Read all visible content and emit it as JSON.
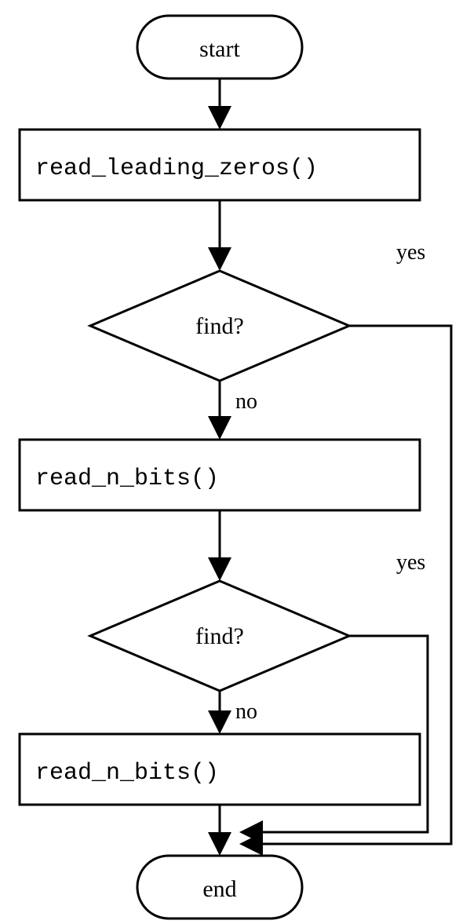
{
  "chart_data": {
    "type": "flowchart",
    "nodes": [
      {
        "id": "start",
        "kind": "terminator",
        "label": "start"
      },
      {
        "id": "p1",
        "kind": "process",
        "label": "read_leading_zeros()"
      },
      {
        "id": "d1",
        "kind": "decision",
        "label": "find?"
      },
      {
        "id": "p2",
        "kind": "process",
        "label": "read_n_bits()"
      },
      {
        "id": "d2",
        "kind": "decision",
        "label": "find?"
      },
      {
        "id": "p3",
        "kind": "process",
        "label": "read_n_bits()"
      },
      {
        "id": "end",
        "kind": "terminator",
        "label": "end"
      }
    ],
    "edges": [
      {
        "from": "start",
        "to": "p1",
        "label": ""
      },
      {
        "from": "p1",
        "to": "d1",
        "label": ""
      },
      {
        "from": "d1",
        "to": "p2",
        "label": "no"
      },
      {
        "from": "d1",
        "to": "end",
        "label": "yes"
      },
      {
        "from": "p2",
        "to": "d2",
        "label": ""
      },
      {
        "from": "d2",
        "to": "p3",
        "label": "no"
      },
      {
        "from": "d2",
        "to": "end",
        "label": "yes"
      },
      {
        "from": "p3",
        "to": "end",
        "label": ""
      }
    ]
  },
  "labels": {
    "start": "start",
    "end": "end",
    "read_leading_zeros": "read_leading_zeros()",
    "read_n_bits_1": "read_n_bits()",
    "read_n_bits_2": "read_n_bits()",
    "find_1": "find?",
    "find_2": "find?",
    "yes_1": "yes",
    "no_1": "no",
    "yes_2": "yes",
    "no_2": "no"
  }
}
